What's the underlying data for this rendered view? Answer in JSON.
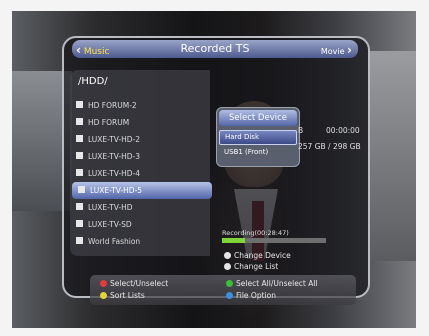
{
  "header": {
    "left_label": "Music",
    "title": "Recorded TS",
    "right_label": "Movie"
  },
  "folder": {
    "path": "/HDD/",
    "items": [
      {
        "label": "HD FORUM-2"
      },
      {
        "label": "HD FORUM"
      },
      {
        "label": "LUXE-TV-HD-2"
      },
      {
        "label": "LUXE-TV-HD-3"
      },
      {
        "label": "LUXE-TV-HD-4"
      },
      {
        "label": "LUXE-TV-HD-5",
        "selected": true
      },
      {
        "label": "LUXE-TV-HD"
      },
      {
        "label": "LUXE-TV-SD"
      },
      {
        "label": "World Fashion"
      }
    ]
  },
  "device_popup": {
    "title": "Select Device",
    "options": [
      "Hard Disk",
      "USB1 (Front)"
    ],
    "selected": "Hard Disk"
  },
  "info": {
    "size_fragment": "B",
    "time": "00:00:00",
    "capacity": "257 GB / 298 GB"
  },
  "recording": {
    "label": "Recording(00:28:47)",
    "progress": 0.22
  },
  "side_hints": [
    {
      "label": "Change Device",
      "color": "#dddddd"
    },
    {
      "label": "Change List",
      "color": "#dddddd"
    }
  ],
  "footer_hints": [
    {
      "label": "Select/Unselect",
      "color": "#e23b3b"
    },
    {
      "label": "Select All/Unselect All",
      "color": "#3bbf3b"
    },
    {
      "label": "Sort Lists",
      "color": "#e6d23b"
    },
    {
      "label": "File Option",
      "color": "#3b8fe0"
    }
  ]
}
